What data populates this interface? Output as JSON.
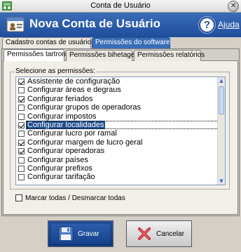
{
  "window": {
    "title": "Conta de Usuário",
    "close_glyph": "✕"
  },
  "header": {
    "title": "Nova Conta de Usuário",
    "help_glyph": "?",
    "help_label": "Ajuda",
    "background_color": "#2a5ba8"
  },
  "outer_tabs": [
    {
      "label": "Cadastro contas de usuários",
      "active": false
    },
    {
      "label": "Permissões do software",
      "active": true
    }
  ],
  "inner_tabs": [
    {
      "label": "Permissões tartron",
      "active": true
    },
    {
      "label": "Permissões bihetagem",
      "active": false
    },
    {
      "label": "Permissões relatórios",
      "active": false
    }
  ],
  "permissions": {
    "group_label": "Selecione as permissões:",
    "items": [
      {
        "label": "Assistente de configuração",
        "checked": true
      },
      {
        "label": "Configurar áreas e degraus",
        "checked": false
      },
      {
        "label": "Configurar feriados",
        "checked": true
      },
      {
        "label": "Configurar grupos de operadoras",
        "checked": false
      },
      {
        "label": "Configurar impostos",
        "checked": false
      },
      {
        "label": "Configurar localidades",
        "checked": true,
        "selected": true
      },
      {
        "label": "Configurar lucro por ramal",
        "checked": false
      },
      {
        "label": "Configurar margem de lucro geral",
        "checked": true
      },
      {
        "label": "Configurar operadoras",
        "checked": true
      },
      {
        "label": "Configurar países",
        "checked": false
      },
      {
        "label": "Configurar prefixos",
        "checked": false
      },
      {
        "label": "Configurar tarifação",
        "checked": false
      }
    ],
    "toggle_all_label": "Marcar todas / Desmarcar todas"
  },
  "buttons": {
    "save_label": "Gravar",
    "cancel_label": "Cancelar"
  },
  "icons": {
    "app": "green-app-icon",
    "header": "user-card-icon",
    "help": "question-icon",
    "save": "floppy-disk-icon",
    "cancel": "red-x-icon",
    "scroll_up": "arrow-up-icon",
    "scroll_down": "arrow-down-icon"
  },
  "scroll_up_glyph": "▲",
  "scroll_down_glyph": "▼"
}
